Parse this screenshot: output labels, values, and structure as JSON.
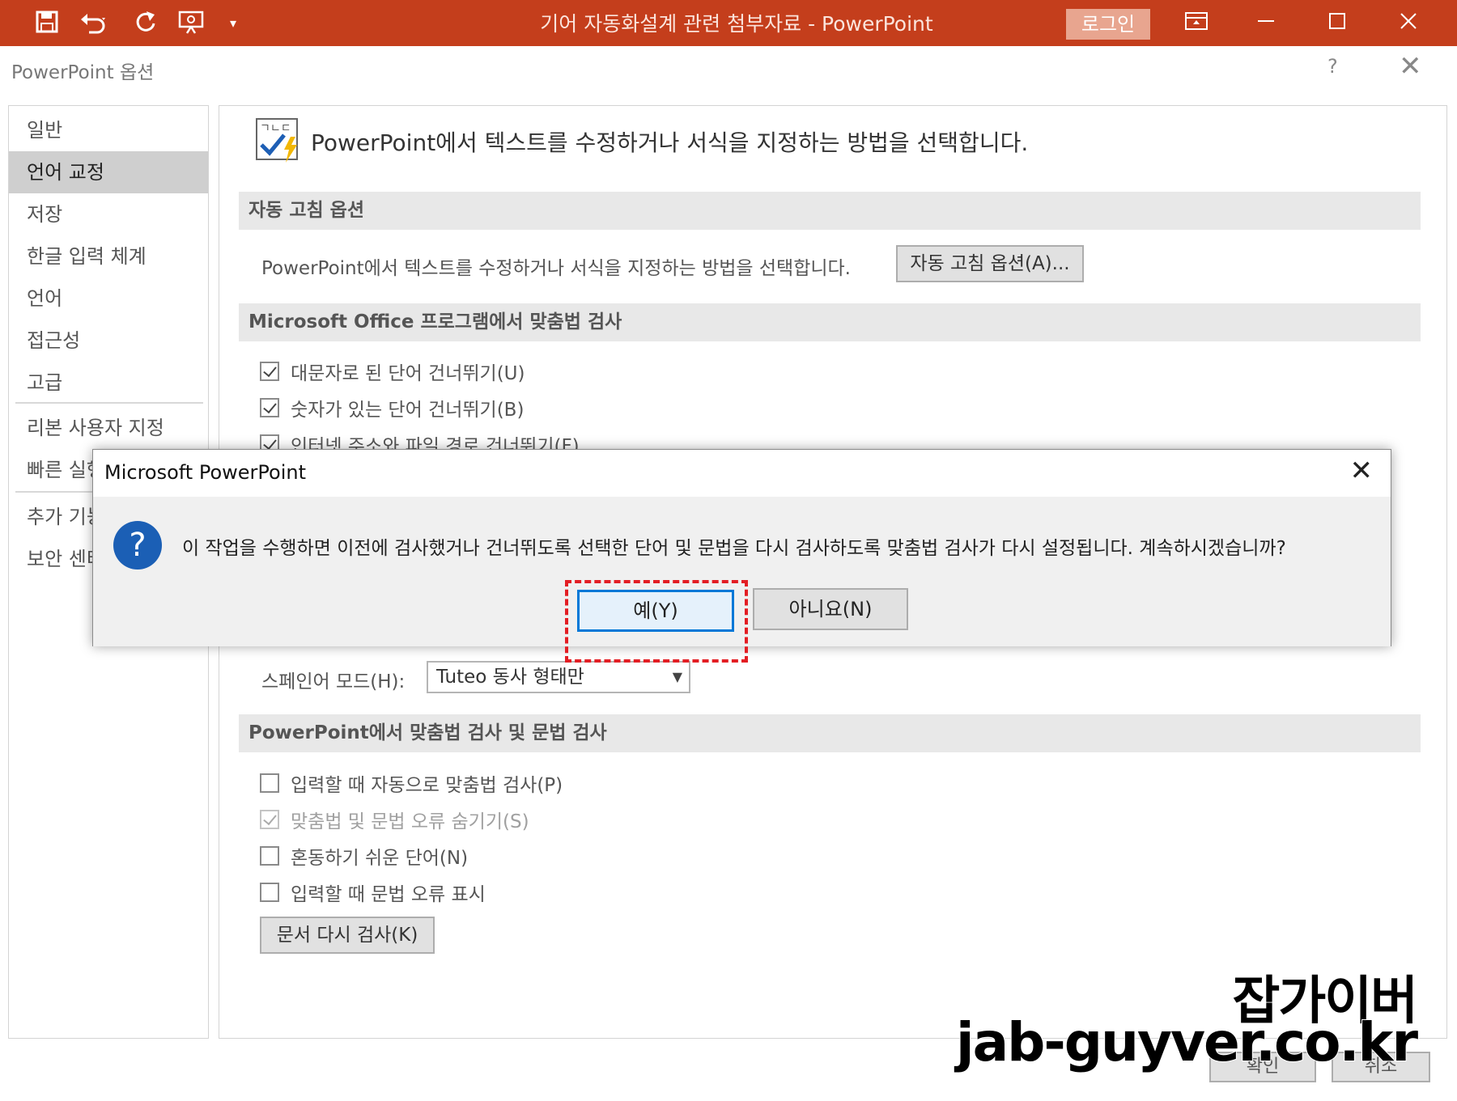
{
  "titlebar": {
    "title": "기어 자동화설계 관련 첨부자료  -  PowerPoint",
    "login_label": "로그인",
    "bg_color": "#c43e1c",
    "icons": [
      "save-icon",
      "undo-icon",
      "redo-icon",
      "slideshow-icon",
      "customize-quick-access-icon"
    ]
  },
  "options_dialog": {
    "title": "PowerPoint 옵션",
    "help": "?",
    "close": "✕"
  },
  "sidebar": {
    "items": [
      {
        "label": "일반"
      },
      {
        "label": "언어 교정",
        "active": true
      },
      {
        "label": "저장"
      },
      {
        "label": "한글 입력 체계"
      },
      {
        "label": "언어"
      },
      {
        "label": "접근성"
      },
      {
        "label": "고급"
      },
      {
        "label": "리본 사용자 지정"
      },
      {
        "label": "빠른 실행"
      },
      {
        "label": "추가 기능"
      },
      {
        "label": "보안 센터"
      }
    ]
  },
  "content": {
    "header": "PowerPoint에서 텍스트를 수정하거나 서식을 지정하는 방법을 선택합니다.",
    "autocorrect": {
      "section_title": "자동 고침 옵션",
      "description": "PowerPoint에서 텍스트를 수정하거나 서식을 지정하는 방법을 선택합니다.",
      "button_label": "자동 고침 옵션(A)..."
    },
    "office_spelling": {
      "section_title": "Microsoft Office 프로그램에서 맞춤법 검사",
      "checkboxes": [
        {
          "label": "대문자로 된 단어 건너뛰기(U)",
          "checked": true
        },
        {
          "label": "숫자가 있는 단어 건너뛰기(B)",
          "checked": true
        },
        {
          "label": "인터넷 주소와 파일 경로 건너뛰기(F)",
          "checked": true
        }
      ],
      "spanish_mode_label": "스페인어 모드(H):",
      "spanish_mode_value": "Tuteo 동사 형태만"
    },
    "ppt_spelling": {
      "section_title": "PowerPoint에서 맞춤법 검사 및 문법 검사",
      "checkboxes": [
        {
          "label": "입력할 때 자동으로 맞춤법 검사(P)",
          "checked": false
        },
        {
          "label": "맞춤법 및 문법 오류 숨기기(S)",
          "checked": true,
          "disabled": true
        },
        {
          "label": "혼동하기 쉬운 단어(N)",
          "checked": false
        },
        {
          "label": "입력할 때 문법 오류 표시",
          "checked": false
        }
      ],
      "recheck_button": "문서 다시 검사(K)"
    }
  },
  "message_box": {
    "title": "Microsoft PowerPoint",
    "close": "✕",
    "icon": "question-icon",
    "icon_glyph": "?",
    "text": "이 작업을 수행하면 이전에 검사했거나 건너뛰도록 선택한 단어 및 문법을 다시 검사하도록 맞춤법 검사가 다시 설정됩니다. 계속하시겠습니까?",
    "yes_label": "예(Y)",
    "no_label": "아니요(N)",
    "highlight_color": "#e31e24"
  },
  "footer": {
    "ok_label": "확인",
    "cancel_label": "취소"
  },
  "watermark": {
    "name": "잡가이버",
    "url": "jab-guyver.co.kr"
  }
}
